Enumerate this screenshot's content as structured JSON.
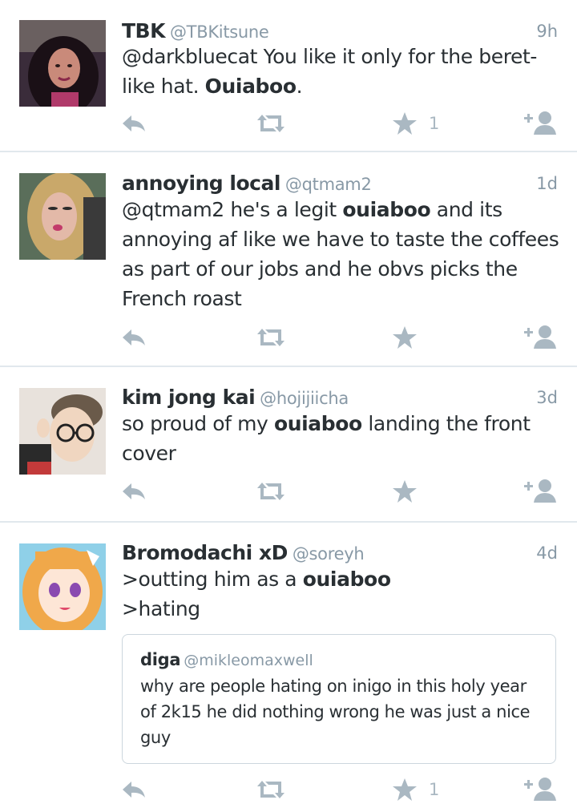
{
  "tweets": [
    {
      "name": "TBK",
      "handle": "@TBKitsune",
      "time": "9h",
      "text_before": "@darkbluecat You like it only for the beret-like hat. ",
      "highlight": "Ouiaboo",
      "text_after": ".",
      "favorite_count": "1"
    },
    {
      "name": "annoying local",
      "handle": "@qtmam2",
      "time": "1d",
      "text_before": "@qtmam2 he's a legit ",
      "highlight": "ouiaboo",
      "text_after": " and its annoying af like we have to taste the coffees as part of our jobs and he obvs picks the French roast",
      "favorite_count": ""
    },
    {
      "name": "kim jong kai",
      "handle": "@hojijiicha",
      "time": "3d",
      "text_before": "so proud of my ",
      "highlight": "ouiaboo",
      "text_after": " landing the front cover",
      "favorite_count": ""
    },
    {
      "name": "Bromodachi xD",
      "handle": "@soreyh",
      "time": "4d",
      "text_before": ">outting him as a ",
      "highlight": "ouiaboo",
      "text_line2": ">hating",
      "favorite_count": "1",
      "quote": {
        "name": "diga",
        "handle": "@mikleomaxwell",
        "text": "why are people hating on inigo in this holy year of 2k15 he did nothing wrong he was just a nice guy"
      }
    }
  ],
  "icons": {
    "reply": "reply-icon",
    "retweet": "retweet-icon",
    "favorite": "star-icon",
    "follow": "follow-user-icon"
  },
  "colors": {
    "name": "#292f33",
    "meta": "#8899a6",
    "action": "#aab8c2",
    "separator": "#e1e8ed"
  }
}
